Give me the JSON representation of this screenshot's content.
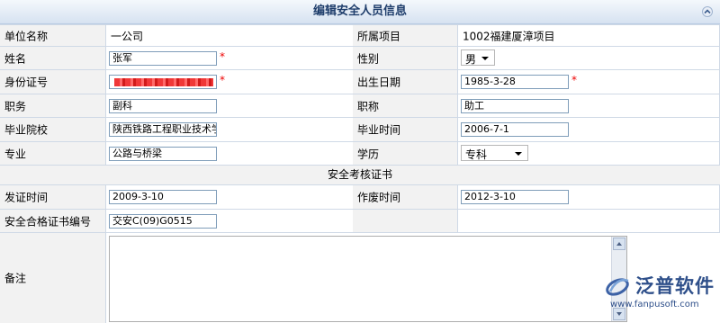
{
  "header": {
    "title": "编辑安全人员信息"
  },
  "form": {
    "company_label": "单位名称",
    "company_value": "一公司",
    "project_label": "所属项目",
    "project_value": "1002福建厦漳项目",
    "name_label": "姓名",
    "name_value": "张军",
    "gender_label": "性别",
    "gender_value": "男",
    "id_label": "身份证号",
    "birth_label": "出生日期",
    "birth_value": "1985-3-28",
    "duty_label": "职务",
    "duty_value": "副科",
    "title_label": "职称",
    "title_value": "助工",
    "school_label": "毕业院校",
    "school_value": "陕西铁路工程职业技术学",
    "grad_label": "毕业时间",
    "grad_value": "2006-7-1",
    "major_label": "专业",
    "major_value": "公路与桥梁",
    "edu_label": "学历",
    "edu_value": "专科",
    "required_mark": "*"
  },
  "cert": {
    "section_title": "安全考核证书",
    "issue_label": "发证时间",
    "issue_value": "2009-3-10",
    "void_label": "作废时间",
    "void_value": "2012-3-10",
    "number_label": "安全合格证书编号",
    "number_value": "交安C(09)G0515",
    "remark_label": "备注",
    "remark_value": ""
  },
  "logo": {
    "name": "泛普软件",
    "url": "www.fanpusoft.com"
  },
  "icons": {
    "collapse": "collapse-up-icon",
    "logo": "fanpu-logo-icon"
  }
}
